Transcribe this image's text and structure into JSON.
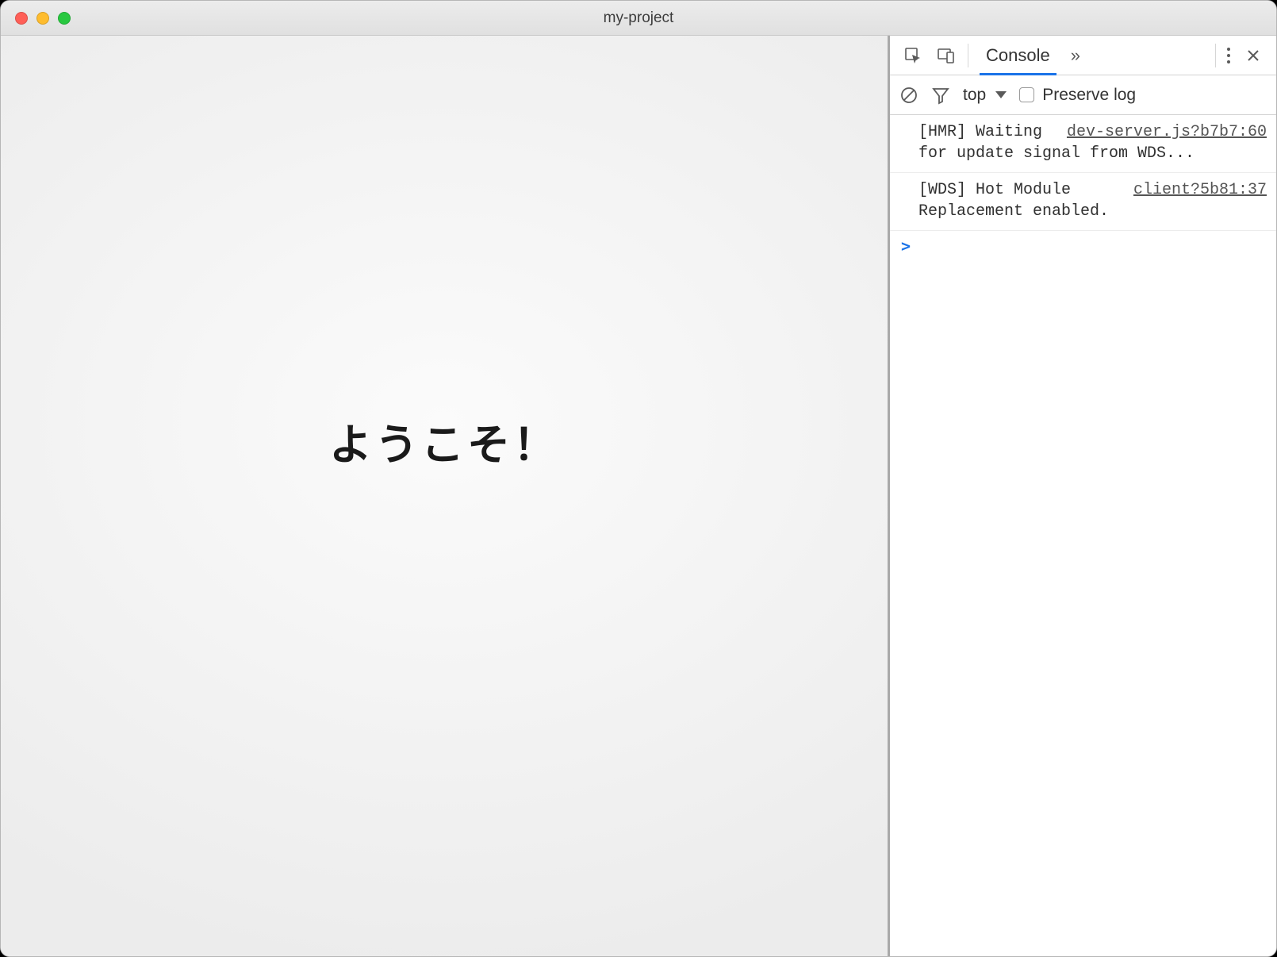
{
  "window": {
    "title": "my-project"
  },
  "page": {
    "welcome_text": "ようこそ！"
  },
  "devtools": {
    "tab_console": "Console",
    "toolbar": {
      "context": "top",
      "preserve_log_label": "Preserve log"
    },
    "logs": [
      {
        "text": "[HMR] Waiting for update signal from WDS...",
        "source": "dev-server.js?b7b7:60"
      },
      {
        "text": "[WDS] Hot Module Replacement enabled.",
        "source": "client?5b81:37"
      }
    ],
    "prompt": ">"
  }
}
